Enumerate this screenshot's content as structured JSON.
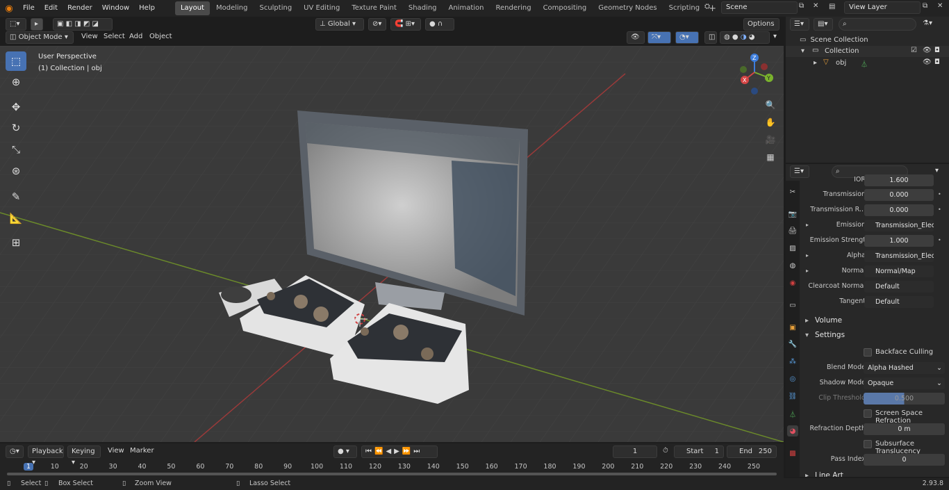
{
  "menu": [
    "File",
    "Edit",
    "Render",
    "Window",
    "Help"
  ],
  "workspaces": [
    "Layout",
    "Modeling",
    "Sculpting",
    "UV Editing",
    "Texture Paint",
    "Shading",
    "Animation",
    "Rendering",
    "Compositing",
    "Geometry Nodes",
    "Scripting"
  ],
  "scene": "Scene",
  "view_layer": "View Layer",
  "viewport": {
    "mode": "Object Mode",
    "menus": [
      "View",
      "Select",
      "Add",
      "Object"
    ],
    "orientation": "Global",
    "options": "Options",
    "perspective": "User Perspective",
    "collection_info": "(1) Collection | obj"
  },
  "gizmo": {
    "z": "Z",
    "y": "Y",
    "x": "X"
  },
  "outliner": {
    "scene_collection": "Scene Collection",
    "collection": "Collection",
    "object": "obj"
  },
  "props": {
    "ior_label": "IOR",
    "ior": "1.600",
    "rows": [
      {
        "label": "Transmission",
        "value": "0.000",
        "type": "num"
      },
      {
        "label": "Transmission R...",
        "value": "0.000",
        "type": "num"
      },
      {
        "label": "Emission",
        "value": "Transmission_Electr...",
        "type": "link",
        "color": "#e3c93a"
      },
      {
        "label": "Emission Strengt",
        "value": "1.000",
        "type": "num"
      },
      {
        "label": "Alpha",
        "value": "Transmission_Electr...",
        "type": "link",
        "color": "#6b6bd8"
      },
      {
        "label": "Normal",
        "value": "Normal/Map",
        "type": "link",
        "color": "#6b6bd8"
      },
      {
        "label": "Clearcoat Normal",
        "value": "Default",
        "type": "link",
        "color": "#6b6bd8"
      },
      {
        "label": "Tangent",
        "value": "Default",
        "type": "link",
        "color": "#6b6bd8"
      }
    ],
    "volume": "Volume",
    "settings": "Settings",
    "backface": "Backface Culling",
    "blend_label": "Blend Mode",
    "blend": "Alpha Hashed",
    "shadow_label": "Shadow Mode",
    "shadow": "Opaque",
    "clip_label": "Clip Threshold",
    "clip": "0.500",
    "ssr": "Screen Space Refraction",
    "refr_label": "Refraction Depth",
    "refr": "0 m",
    "sss": "Subsurface Translucency",
    "pass_label": "Pass Index",
    "pass": "0",
    "line_art": "Line Art"
  },
  "timeline": {
    "menus": [
      "Playback",
      "Keying",
      "View",
      "Marker"
    ],
    "current": "1",
    "start_label": "Start",
    "start": "1",
    "end_label": "End",
    "end": "250",
    "ticks": [
      "1",
      "10",
      "20",
      "30",
      "40",
      "50",
      "60",
      "70",
      "80",
      "90",
      "100",
      "110",
      "120",
      "130",
      "140",
      "150",
      "160",
      "170",
      "180",
      "190",
      "200",
      "210",
      "220",
      "230",
      "240",
      "250"
    ]
  },
  "status": {
    "select": "Select",
    "box": "Box Select",
    "zoom": "Zoom View",
    "lasso": "Lasso Select",
    "version": "2.93.8"
  }
}
